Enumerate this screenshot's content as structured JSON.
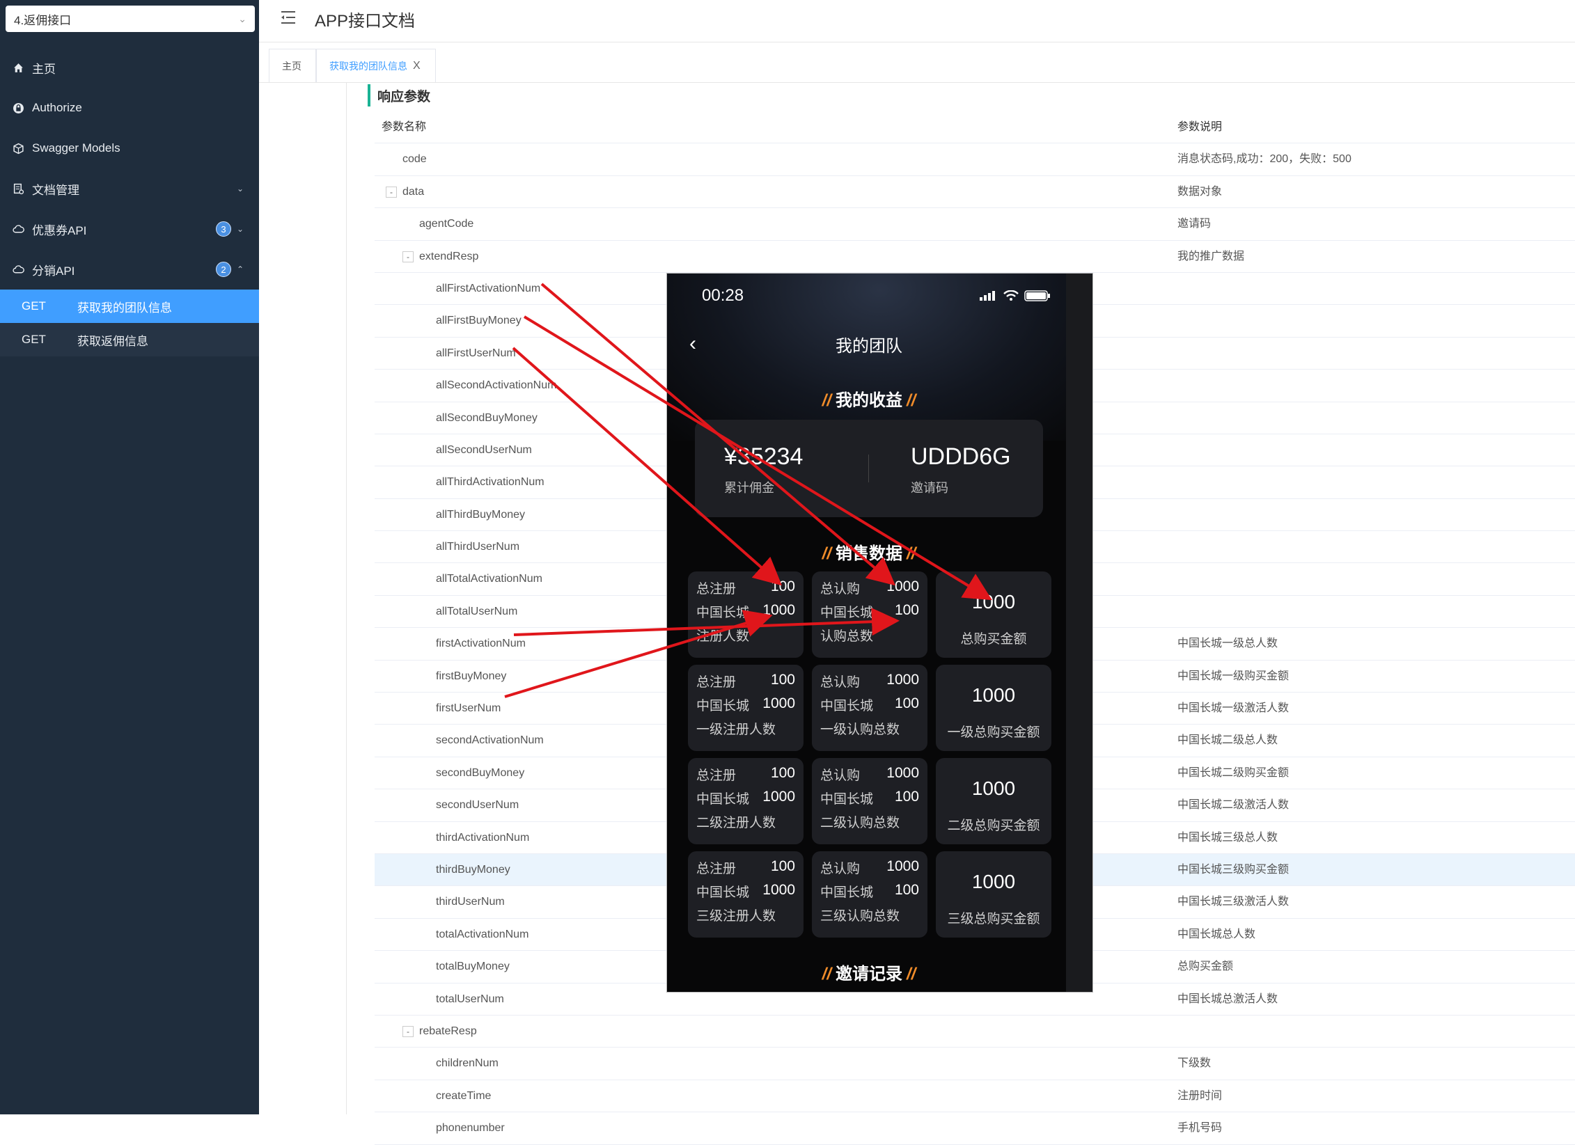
{
  "sidebar": {
    "api_select": "4.返佣接口",
    "nav": [
      {
        "label": "主页",
        "icon": "home-icon"
      },
      {
        "label": "Authorize",
        "icon": "lock-icon"
      },
      {
        "label": "Swagger Models",
        "icon": "cube-icon"
      },
      {
        "label": "文档管理",
        "icon": "doc-icon"
      },
      {
        "label": "优惠券API",
        "icon": "cloud-icon",
        "badge": "3"
      },
      {
        "label": "分销API",
        "icon": "cloud-icon",
        "badge": "2"
      }
    ],
    "sub": [
      {
        "method": "GET",
        "label": "获取我的团队信息",
        "active": true
      },
      {
        "method": "GET",
        "label": "获取返佣信息",
        "active": false
      }
    ]
  },
  "header": {
    "title": "APP接口文档"
  },
  "tabs": [
    {
      "label": "主页"
    },
    {
      "label": "获取我的团队信息",
      "close": "X"
    }
  ],
  "section": {
    "title": "响应参数"
  },
  "table": {
    "col_name": "参数名称",
    "col_desc": "参数说明",
    "rows": [
      {
        "name": "code",
        "desc": "消息状态码,成功：200，失败：500",
        "level": 0
      },
      {
        "name": "data",
        "desc": "数据对象",
        "level": 0,
        "toggle": "-"
      },
      {
        "name": "agentCode",
        "desc": "邀请码",
        "level": 1
      },
      {
        "name": "extendResp",
        "desc": "我的推广数据",
        "level": 1,
        "toggle": "-"
      },
      {
        "name": "allFirstActivationNum",
        "desc": "",
        "level": 2
      },
      {
        "name": "allFirstBuyMoney",
        "desc": "",
        "level": 2
      },
      {
        "name": "allFirstUserNum",
        "desc": "",
        "level": 2
      },
      {
        "name": "allSecondActivationNum",
        "desc": "",
        "level": 2
      },
      {
        "name": "allSecondBuyMoney",
        "desc": "",
        "level": 2
      },
      {
        "name": "allSecondUserNum",
        "desc": "",
        "level": 2
      },
      {
        "name": "allThirdActivationNum",
        "desc": "",
        "level": 2
      },
      {
        "name": "allThirdBuyMoney",
        "desc": "",
        "level": 2
      },
      {
        "name": "allThirdUserNum",
        "desc": "",
        "level": 2
      },
      {
        "name": "allTotalActivationNum",
        "desc": "",
        "level": 2
      },
      {
        "name": "allTotalUserNum",
        "desc": "",
        "level": 2
      },
      {
        "name": "firstActivationNum",
        "desc": "中国长城一级总人数",
        "level": 2
      },
      {
        "name": "firstBuyMoney",
        "desc": "中国长城一级购买金额",
        "level": 2
      },
      {
        "name": "firstUserNum",
        "desc": "中国长城一级激活人数",
        "level": 2
      },
      {
        "name": "secondActivationNum",
        "desc": "中国长城二级总人数",
        "level": 2
      },
      {
        "name": "secondBuyMoney",
        "desc": "中国长城二级购买金额",
        "level": 2
      },
      {
        "name": "secondUserNum",
        "desc": "中国长城二级激活人数",
        "level": 2
      },
      {
        "name": "thirdActivationNum",
        "desc": "中国长城三级总人数",
        "level": 2
      },
      {
        "name": "thirdBuyMoney",
        "desc": "中国长城三级购买金额",
        "level": 2,
        "highlight": true
      },
      {
        "name": "thirdUserNum",
        "desc": "中国长城三级激活人数",
        "level": 2
      },
      {
        "name": "totalActivationNum",
        "desc": "中国长城总人数",
        "level": 2
      },
      {
        "name": "totalBuyMoney",
        "desc": "总购买金额",
        "level": 2
      },
      {
        "name": "totalUserNum",
        "desc": "中国长城总激活人数",
        "level": 2
      },
      {
        "name": "rebateResp",
        "desc": "",
        "level": 1,
        "toggle": "-"
      },
      {
        "name": "childrenNum",
        "desc": "下级数",
        "level": 2
      },
      {
        "name": "createTime",
        "desc": "注册时间",
        "level": 2
      },
      {
        "name": "phonenumber",
        "desc": "手机号码",
        "level": 2
      }
    ]
  },
  "phone": {
    "time": "00:28",
    "title": "我的团队",
    "sec_earnings": "我的收益",
    "sec_sales": "销售数据",
    "sec_invite": "邀请记录",
    "slashes": "//",
    "earn": {
      "amount": "¥35234",
      "amount_label": "累计佣金",
      "code": "UDDD6G",
      "code_label": "邀请码"
    },
    "rows": [
      {
        "reg": {
          "l1": "总注册",
          "v1": "100",
          "l2": "中国长城",
          "v2": "1000",
          "cap": "注册人数"
        },
        "buy": {
          "l1": "总认购",
          "v1": "1000",
          "l2": "中国长城",
          "v2": "100",
          "cap": "认购总数"
        },
        "amt": {
          "val": "1000",
          "cap": "总购买金额"
        }
      },
      {
        "reg": {
          "l1": "总注册",
          "v1": "100",
          "l2": "中国长城",
          "v2": "1000",
          "cap": "一级注册人数"
        },
        "buy": {
          "l1": "总认购",
          "v1": "1000",
          "l2": "中国长城",
          "v2": "100",
          "cap": "一级认购总数"
        },
        "amt": {
          "val": "1000",
          "cap": "一级总购买金额"
        }
      },
      {
        "reg": {
          "l1": "总注册",
          "v1": "100",
          "l2": "中国长城",
          "v2": "1000",
          "cap": "二级注册人数"
        },
        "buy": {
          "l1": "总认购",
          "v1": "1000",
          "l2": "中国长城",
          "v2": "100",
          "cap": "二级认购总数"
        },
        "amt": {
          "val": "1000",
          "cap": "二级总购买金额"
        }
      },
      {
        "reg": {
          "l1": "总注册",
          "v1": "100",
          "l2": "中国长城",
          "v2": "1000",
          "cap": "三级注册人数"
        },
        "buy": {
          "l1": "总认购",
          "v1": "1000",
          "l2": "中国长城",
          "v2": "100",
          "cap": "三级认购总数"
        },
        "amt": {
          "val": "1000",
          "cap": "三级总购买金额"
        }
      }
    ]
  },
  "colors": {
    "sidebar_bg": "#1f2d3d",
    "active": "#409eff",
    "accent": "#1ab394",
    "arrow": "#e0161b",
    "slash": "#f08c2a"
  }
}
